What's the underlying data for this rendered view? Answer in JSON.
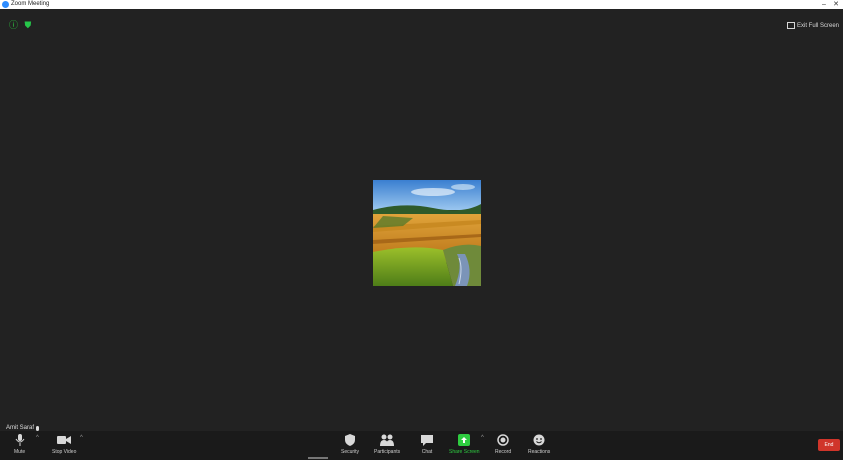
{
  "window": {
    "title": "Zoom Meeting",
    "minimize_glyph": "–",
    "close_glyph": "✕"
  },
  "meeting": {
    "fullscreen_label": "Exit Full Screen",
    "participant_name": "Amit Saraf"
  },
  "toolbar": {
    "left": [
      {
        "key": "mute",
        "label": "Mute",
        "icon": "microphone-icon"
      },
      {
        "key": "stop_video",
        "label": "Stop Video",
        "icon": "video-camera-icon"
      }
    ],
    "center": [
      {
        "key": "security",
        "label": "Security",
        "icon": "shield-icon"
      },
      {
        "key": "participants",
        "label": "Participants",
        "icon": "participants-icon"
      },
      {
        "key": "chat",
        "label": "Chat",
        "icon": "chat-icon"
      },
      {
        "key": "share_screen",
        "label": "Share Screen",
        "icon": "share-screen-icon",
        "color": "#2ecc40"
      },
      {
        "key": "record",
        "label": "Record",
        "icon": "record-icon"
      },
      {
        "key": "reactions",
        "label": "Reactions",
        "icon": "reactions-icon"
      }
    ],
    "end_label": "End"
  },
  "colors": {
    "stage_bg": "#222222",
    "toolbar_bg": "#1a1a1a",
    "end_red": "#d0352a",
    "share_green": "#2ecc40",
    "title_bar": "#ffffff"
  }
}
